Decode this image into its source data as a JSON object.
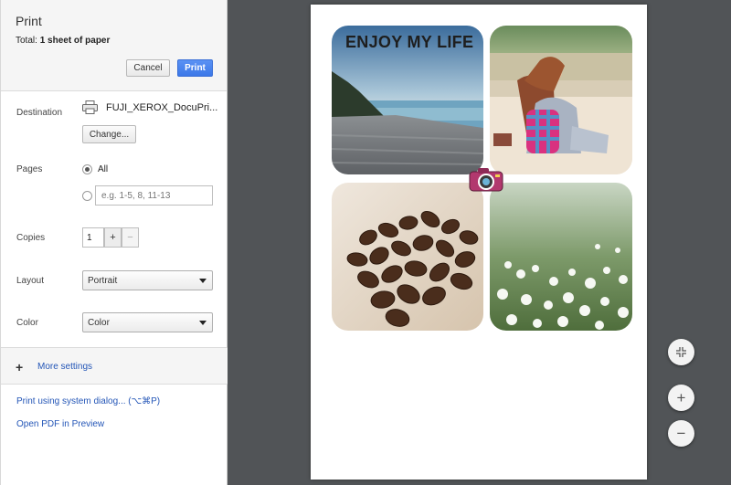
{
  "dialog": {
    "title": "Print",
    "total_prefix": "Total: ",
    "total_value": "1 sheet of paper",
    "cancel_label": "Cancel",
    "print_label": "Print"
  },
  "destination": {
    "label": "Destination",
    "printer_icon": "printer-icon",
    "printer_name": "FUJI_XEROX_DocuPri...",
    "change_label": "Change..."
  },
  "pages": {
    "label": "Pages",
    "all_label": "All",
    "all_selected": true,
    "custom_placeholder": "e.g. 1-5, 8, 11-13"
  },
  "copies": {
    "label": "Copies",
    "value": "1",
    "plus_label": "+",
    "minus_label": "−"
  },
  "layout": {
    "label": "Layout",
    "selected": "Portrait"
  },
  "color": {
    "label": "Color",
    "selected": "Color"
  },
  "more_settings": {
    "icon": "plus-icon",
    "label": "More settings"
  },
  "links": {
    "system_dialog": "Print using system dialog... (⌥⌘P)",
    "open_pdf": "Open PDF in Preview"
  },
  "preview": {
    "headline": "ENJOY MY LIFE",
    "photos": [
      "beach-photo",
      "girl-on-beach-photo",
      "coffee-beans-photo",
      "white-flowers-photo"
    ],
    "camera_icon": "camera-icon"
  },
  "zoom_controls": {
    "fit_icon": "fit-to-page-icon",
    "zoom_in_label": "+",
    "zoom_out_label": "−"
  },
  "colors": {
    "accent": "#3c78e8",
    "link": "#2456b7",
    "preview_bg": "#515457"
  }
}
